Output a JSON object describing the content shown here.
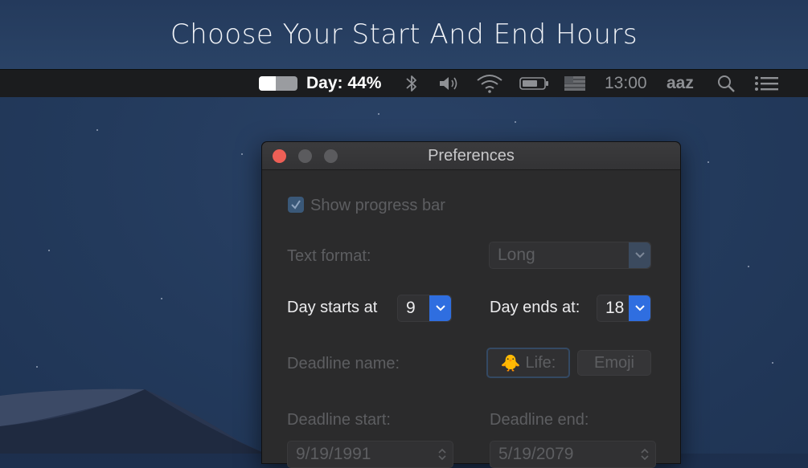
{
  "banner": {
    "title": "Choose Your Start And End Hours"
  },
  "menubar": {
    "progress_toggle": {
      "fill_fraction": 0.44
    },
    "day_text": "Day: 44%",
    "icons": [
      "bluetooth-icon",
      "volume-icon",
      "wifi-icon",
      "battery-icon",
      "flag-icon"
    ],
    "clock": "13:00",
    "user": "aaz",
    "right_icons": [
      "spotlight-search-icon",
      "notification-center-icon"
    ]
  },
  "window": {
    "title": "Preferences",
    "show_progress_bar": {
      "label": "Show progress bar",
      "checked": true
    },
    "text_format": {
      "label": "Text format:",
      "value": "Long"
    },
    "day_starts": {
      "label": "Day starts at",
      "value": "9"
    },
    "day_ends": {
      "label": "Day ends at:",
      "value": "18"
    },
    "deadline_name": {
      "label": "Deadline name:",
      "emoji": "🐥",
      "value": "Life:",
      "emoji_button": "Emoji"
    },
    "deadline_start": {
      "label": "Deadline start:",
      "value": "9/19/1991"
    },
    "deadline_end": {
      "label": "Deadline end:",
      "value": "5/19/2079"
    }
  },
  "colors": {
    "accent": "#2f6ee0",
    "close": "#ed5f56",
    "window_bg": "#2b2b2c",
    "menubar_bg": "#1b1c1e"
  }
}
